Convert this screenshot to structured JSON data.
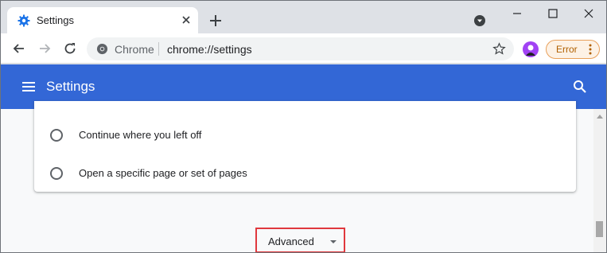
{
  "tab": {
    "title": "Settings",
    "favicon": "gear-icon"
  },
  "omnibox": {
    "chip": "Chrome",
    "url": "chrome://settings"
  },
  "profile": {
    "error_label": "Error"
  },
  "header": {
    "title": "Settings"
  },
  "startup": {
    "options": [
      {
        "label": "Continue where you left off",
        "selected": false
      },
      {
        "label": "Open a specific page or set of pages",
        "selected": false
      }
    ]
  },
  "advanced": {
    "label": "Advanced"
  },
  "colors": {
    "header_bg": "#3367d6",
    "highlight_box": "#e0383d",
    "error_text": "#b06000",
    "avatar": "#a142f4"
  }
}
